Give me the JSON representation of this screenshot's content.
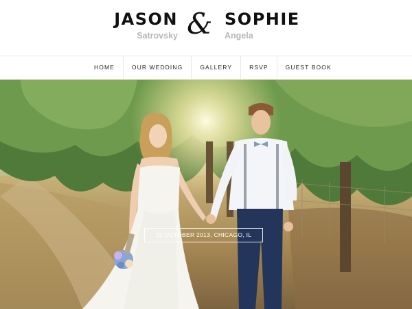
{
  "couple": {
    "groom_first": "JASON",
    "groom_last": "Satrovsky",
    "ampersand": "&",
    "bride_first": "SOPHIE",
    "bride_last": "Angela"
  },
  "nav": {
    "items": [
      {
        "label": "HOME"
      },
      {
        "label": "OUR WEDDING"
      },
      {
        "label": "GALLERY"
      },
      {
        "label": "RSVP"
      },
      {
        "label": "GUEST BOOK"
      }
    ]
  },
  "hero": {
    "date_location": "23 OCTOBER 2013, CHICAGO, IL"
  }
}
